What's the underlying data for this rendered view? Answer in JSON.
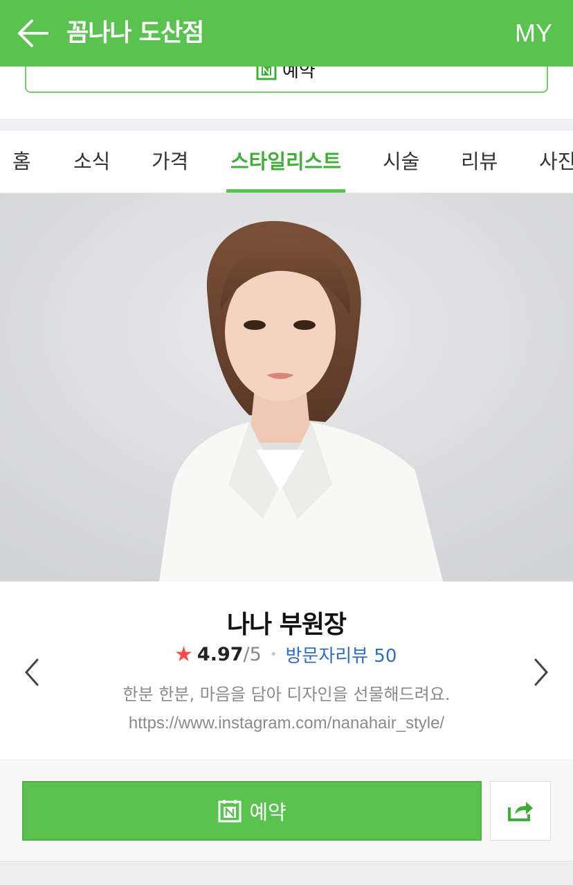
{
  "header": {
    "title": "꼼나나 도산점",
    "my_label": "MY"
  },
  "booking_top": {
    "label": "예약"
  },
  "tabs": [
    {
      "label": "홈"
    },
    {
      "label": "소식"
    },
    {
      "label": "가격"
    },
    {
      "label": "스타일리스트",
      "active": true
    },
    {
      "label": "시술"
    },
    {
      "label": "리뷰"
    },
    {
      "label": "사진"
    }
  ],
  "stylist": {
    "name": "나나 부원장",
    "rating": "4.97",
    "rating_scale": "/5",
    "review_label": "방문자리뷰 50",
    "intro": "한분 한분, 마음을 담아 디자인을 선물해드려요.",
    "instagram": "https://www.instagram.com/nanahair_style/"
  },
  "actions": {
    "reserve_label": "예약",
    "share_icon": "share-icon"
  },
  "colors": {
    "brand": "#5ac350",
    "active_tab": "#3fae39",
    "link": "#2e6dc2",
    "star": "#ff4a4a"
  }
}
